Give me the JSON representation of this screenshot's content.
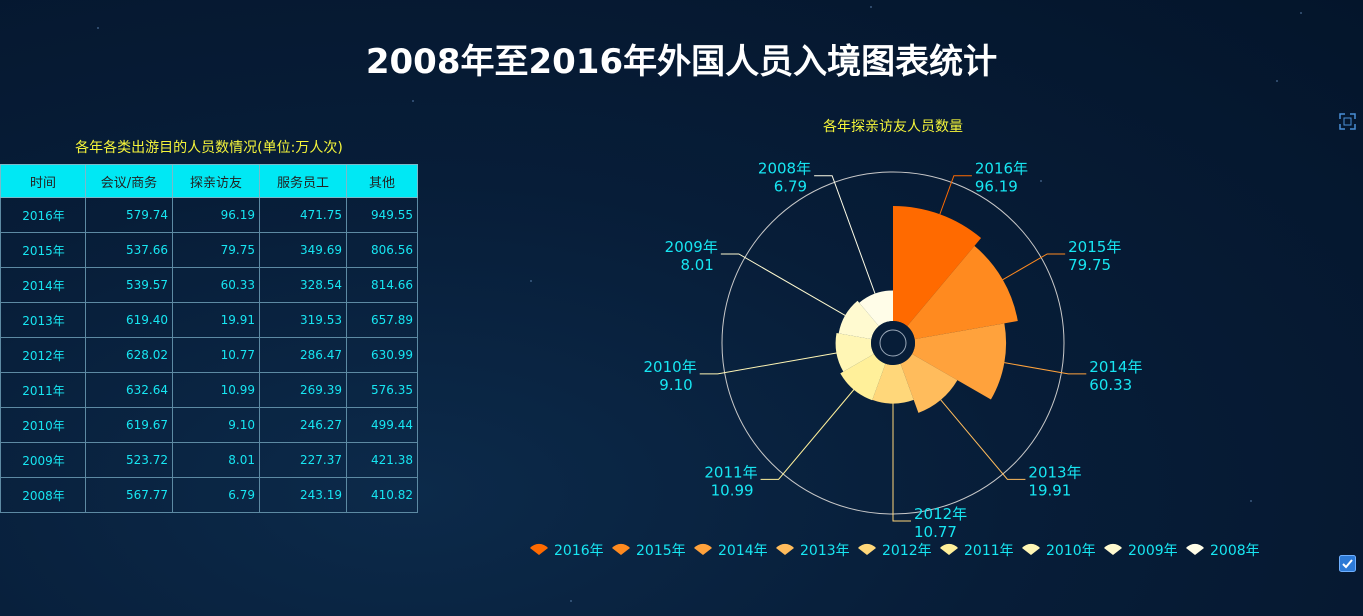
{
  "page": {
    "title": "2008年至2016年外国人员入境图表统计"
  },
  "table": {
    "title": "各年各类出游目的人员数情况(单位:万人次)",
    "headers": [
      "时间",
      "会议/商务",
      "探亲访友",
      "服务员工",
      "其他"
    ],
    "rows": [
      [
        "2016年",
        "579.74",
        "96.19",
        "471.75",
        "949.55"
      ],
      [
        "2015年",
        "537.66",
        "79.75",
        "349.69",
        "806.56"
      ],
      [
        "2014年",
        "539.57",
        "60.33",
        "328.54",
        "814.66"
      ],
      [
        "2013年",
        "619.40",
        "19.91",
        "319.53",
        "657.89"
      ],
      [
        "2012年",
        "628.02",
        "10.77",
        "286.47",
        "630.99"
      ],
      [
        "2011年",
        "632.64",
        "10.99",
        "269.39",
        "576.35"
      ],
      [
        "2010年",
        "619.67",
        "9.10",
        "246.27",
        "499.44"
      ],
      [
        "2009年",
        "523.72",
        "8.01",
        "227.37",
        "421.38"
      ],
      [
        "2008年",
        "567.77",
        "6.79",
        "243.19",
        "410.82"
      ]
    ]
  },
  "chart_data": {
    "type": "pie",
    "subtype": "rose",
    "title": "各年探亲访友人员数量",
    "categories": [
      "2016年",
      "2015年",
      "2014年",
      "2013年",
      "2012年",
      "2011年",
      "2010年",
      "2009年",
      "2008年"
    ],
    "values": [
      96.19,
      79.75,
      60.33,
      19.91,
      10.77,
      10.99,
      9.1,
      8.01,
      6.79
    ],
    "value_labels": [
      "96.19",
      "79.75",
      "60.33",
      "19.91",
      "10.77",
      "10.99",
      "9.10",
      "8.01",
      "6.79"
    ],
    "colors": [
      "#ff6a00",
      "#ff8a1f",
      "#ffa23c",
      "#ffbc5c",
      "#ffd77a",
      "#fff09a",
      "#fff6b5",
      "#fffad0",
      "#fffde8"
    ],
    "legend": {
      "position": "bottom",
      "items": [
        "2016年",
        "2015年",
        "2014年",
        "2013年",
        "2012年",
        "2011年",
        "2010年",
        "2009年",
        "2008年"
      ]
    },
    "label_color": "#17e6f2",
    "title_color": "#f5f53a"
  },
  "icons": {
    "fullscreen": "fullscreen-icon",
    "checkbox": "checkbox-icon"
  }
}
